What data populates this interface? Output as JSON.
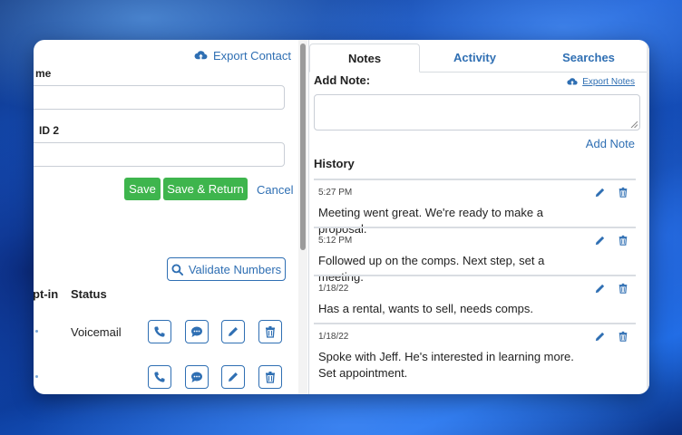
{
  "left": {
    "export_contact_label": "Export Contact",
    "field1_label": "me",
    "field1_value": "",
    "field2_label": "ID 2",
    "field2_value": "",
    "save_label": "Save",
    "save_return_label": "Save & Return",
    "cancel_label": "Cancel",
    "validate_label": "Validate Numbers",
    "col_optin": "pt-in",
    "col_status": "Status",
    "rows": [
      {
        "status": "Voicemail"
      },
      {
        "status": ""
      }
    ]
  },
  "right": {
    "tabs": [
      {
        "label": "Notes",
        "active": true
      },
      {
        "label": "Activity",
        "active": false
      },
      {
        "label": "Searches",
        "active": false
      }
    ],
    "add_note_label": "Add Note:",
    "export_notes_label": "Export Notes",
    "note_value": "",
    "add_note_link": "Add Note",
    "history_title": "History",
    "history": [
      {
        "time": "5:27 PM",
        "text": "Meeting went great. We're ready to make a proposal."
      },
      {
        "time": "5:12 PM",
        "text": "Followed up on the comps. Next step, set a meeting."
      },
      {
        "time": "1/18/22",
        "text": "Has a rental, wants to sell, needs comps."
      },
      {
        "time": "1/18/22",
        "text": "Spoke with Jeff. He's interested in learning more. Set appointment."
      }
    ]
  },
  "colors": {
    "accent": "#2f6fb3",
    "green": "#3eb54d"
  },
  "icons": {
    "export": "cloud-upload-icon",
    "search": "search-icon",
    "phone": "phone-icon",
    "message": "chat-icon",
    "edit": "pencil-icon",
    "delete": "trash-icon"
  }
}
